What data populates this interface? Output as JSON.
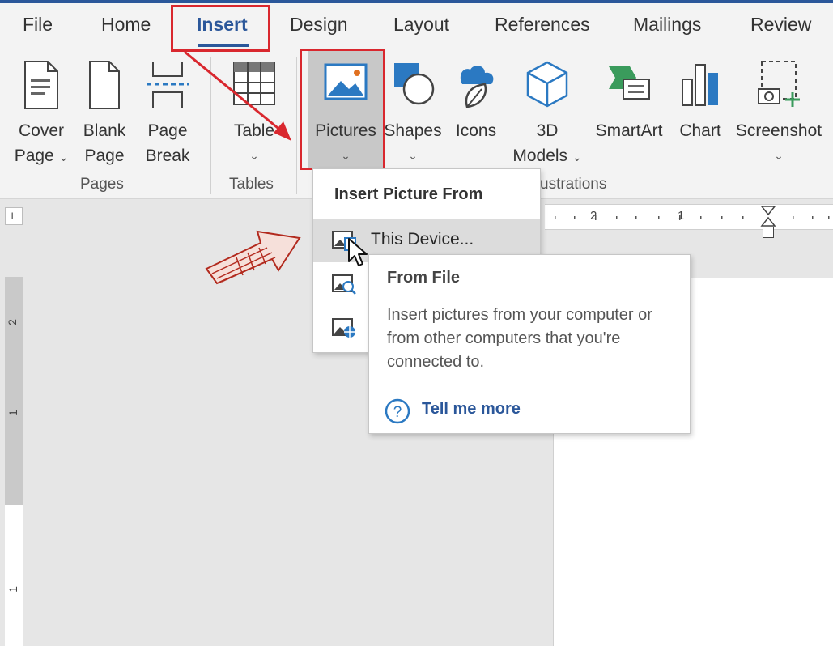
{
  "tabs": [
    "File",
    "Home",
    "Insert",
    "Design",
    "Layout",
    "References",
    "Mailings",
    "Review"
  ],
  "active_tab": "Insert",
  "ribbon": {
    "cover_page": [
      "Cover",
      "Page"
    ],
    "blank_page": [
      "Blank",
      "Page"
    ],
    "page_break": [
      "Page",
      "Break"
    ],
    "table": "Table",
    "pictures": "Pictures",
    "shapes": "Shapes",
    "icons": "Icons",
    "models_3d": [
      "3D",
      "Models"
    ],
    "smartart": "SmartArt",
    "chart": "Chart",
    "screenshot": "Screenshot",
    "groups": {
      "pages": "Pages",
      "tables": "Tables",
      "illustrations": "ustrations"
    }
  },
  "ruler": {
    "h_ticks": [
      "2",
      "1"
    ],
    "v_ticks": [
      "2",
      "1",
      "1"
    ],
    "corner": "L"
  },
  "dropdown": {
    "header": "Insert Picture From",
    "items": [
      {
        "label": "This Device...",
        "icon": "picture-device-icon"
      },
      {
        "label": "",
        "icon": "picture-search-icon"
      },
      {
        "label": "",
        "icon": "picture-online-icon"
      }
    ]
  },
  "tooltip": {
    "title": "From File",
    "body": "Insert pictures from your computer or from other computers that you're connected to.",
    "link": "Tell me more"
  },
  "colors": {
    "accent": "#2b579a",
    "annotation_red": "#d9272e",
    "ribbon_bg": "#f3f3f3"
  }
}
